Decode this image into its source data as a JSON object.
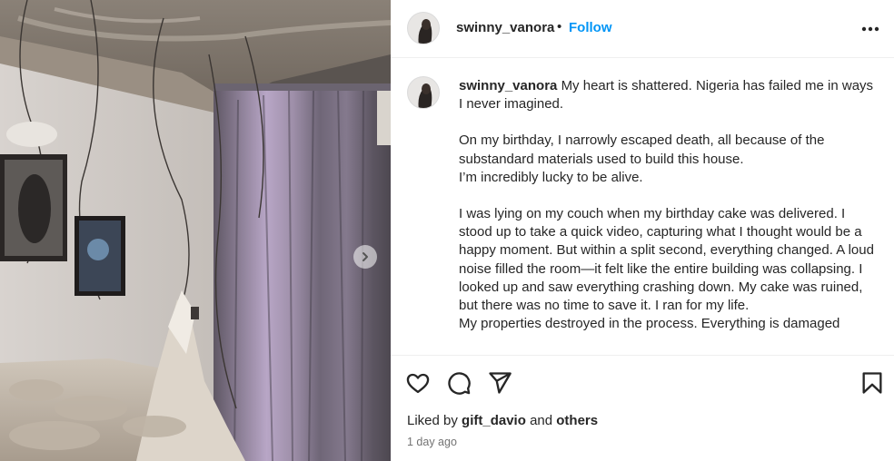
{
  "header": {
    "username": "swinny_vanora",
    "separator": "•",
    "follow_label": "Follow",
    "more_icon": "more-options-icon"
  },
  "caption": {
    "username": "swinny_vanora",
    "paragraphs": [
      [
        "My heart is shattered. Nigeria has failed me in ways I never imagined."
      ],
      [
        "On my birthday, I narrowly escaped death, all because of the substandard materials used to build this house.",
        "I’m incredibly lucky to be alive."
      ],
      [
        "I was lying on my couch when my birthday cake was delivered. I stood up to take a quick video, capturing what I thought would be a happy moment. But within a split second, everything changed. A loud noise filled the room—it felt like the entire building was collapsing. I looked up and saw everything crashing down. My cake was ruined, but there was no time to save it. I ran for my life.",
        "My properties destroyed in the process. Everything is damaged"
      ]
    ]
  },
  "actions": {
    "icons": [
      "heart-icon",
      "comment-icon",
      "share-icon",
      "bookmark-icon"
    ],
    "liked_by_prefix": "Liked by",
    "liked_by_user": "gift_davio",
    "liked_by_and": "and",
    "liked_by_others": "others",
    "timestamp": "1 day ago"
  },
  "media": {
    "description_icon": "carousel-next-icon"
  }
}
